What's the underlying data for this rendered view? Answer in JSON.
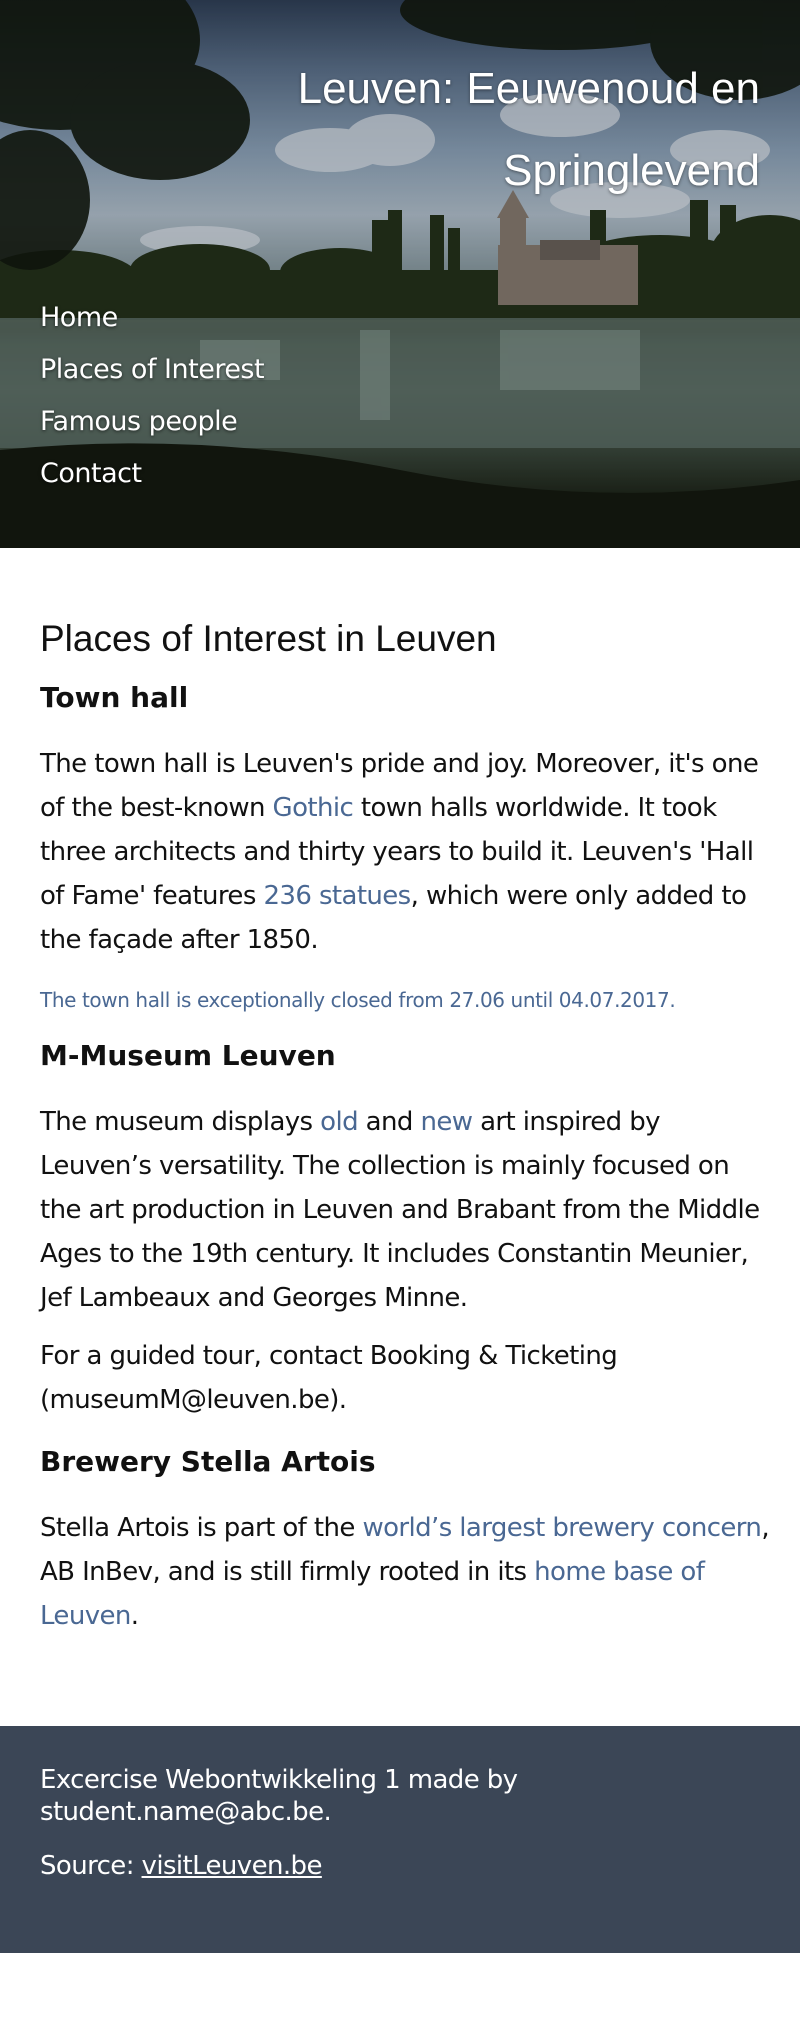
{
  "header": {
    "title": "Leuven: Eeuwenoud en Springlevend"
  },
  "nav": {
    "items": [
      {
        "label": "Home"
      },
      {
        "label": "Places of Interest"
      },
      {
        "label": "Famous people"
      },
      {
        "label": "Contact"
      }
    ]
  },
  "main": {
    "heading": "Places of Interest in Leuven",
    "town_hall": {
      "heading": "Town hall",
      "text_1": "The town hall is Leuven's pride and joy. Moreover, it's one of the best-known ",
      "link_gothic": "Gothic",
      "text_2": " town halls worldwide. It took three architects and thirty years to build it. Leuven's 'Hall of Fame' features ",
      "link_statues": "236 statues",
      "text_3": ", which were only added to the façade after 1850.",
      "notice": "The town hall is exceptionally closed from 27.06 until 04.07.2017."
    },
    "museum": {
      "heading": "M-Museum Leuven",
      "text_1": "The museum displays ",
      "link_old": "old",
      "text_2": " and ",
      "link_new": "new",
      "text_3": " art inspired by Leuven’s versatility. The collection is mainly focused on the art production in Leuven and Brabant from the Middle Ages to the 19th century. It includes Constantin Meunier, Jef Lambeaux and Georges Minne.",
      "tour_text": "For a guided tour, contact Booking & Ticketing (museumM@leuven.be)."
    },
    "brewery": {
      "heading": "Brewery Stella Artois",
      "text_1": "Stella Artois is part of the ",
      "link_concern": "world’s largest brewery concern",
      "text_2": ", AB InBev, and is still firmly rooted in its ",
      "link_home": "home base of Leuven",
      "text_3": "."
    }
  },
  "footer": {
    "credit": "Excercise Webontwikkeling 1 made by student.name@abc.be.",
    "source_label": "Source: ",
    "source_link": "visitLeuven.be"
  },
  "colors": {
    "link": "#4a6893",
    "footer_bg": "#3b4656",
    "text": "#111111"
  }
}
